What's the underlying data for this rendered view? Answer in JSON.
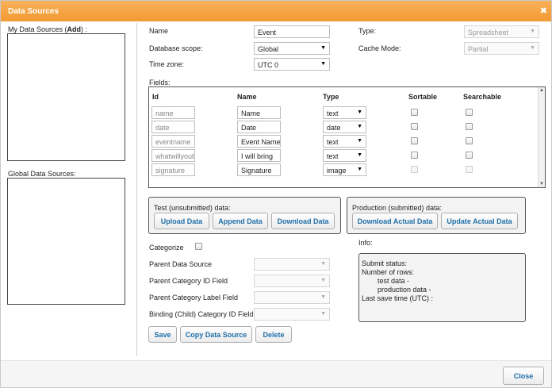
{
  "dialog": {
    "title": "Data Sources",
    "close_glyph": "✖"
  },
  "left": {
    "my_label_prefix": "My Data Sources (",
    "my_label_link": "Add",
    "my_label_suffix": ") :",
    "global_label": "Global Data Sources:"
  },
  "settings": {
    "name_label": "Name",
    "name_value": "Event",
    "scope_label": "Database scope:",
    "scope_value": "Global",
    "timezone_label": "Time zone:",
    "timezone_value": "UTC 0",
    "type_label": "Type:",
    "type_value": "Spreadsheet",
    "cache_label": "Cache Mode:",
    "cache_value": "Partial"
  },
  "fields": {
    "label": "Fields:",
    "headers": {
      "id": "Id",
      "name": "Name",
      "type": "Type",
      "sortable": "Sortable",
      "searchable": "Searchable"
    },
    "rows": [
      {
        "id": "name",
        "name": "Name",
        "type": "text",
        "checks_enabled": true
      },
      {
        "id": "date",
        "name": "Date",
        "type": "date",
        "checks_enabled": true
      },
      {
        "id": "eventname",
        "name": "Event Name",
        "type": "text",
        "checks_enabled": true
      },
      {
        "id": "whatwillyoubr",
        "name": "I will bring",
        "type": "text",
        "checks_enabled": true
      },
      {
        "id": "signature",
        "name": "Signature",
        "type": "image",
        "checks_enabled": false
      }
    ]
  },
  "test_group": {
    "title": "Test (unsubmitted) data:",
    "upload": "Upload Data",
    "append": "Append Data",
    "download": "Download Data"
  },
  "prod_group": {
    "title": "Production (submitted) data:",
    "download_actual": "Download Actual Data",
    "update_actual": "Update Actual Data"
  },
  "categorize": {
    "label": "Categorize",
    "parent_source": "Parent Data Source",
    "parent_id": "Parent Category ID Field",
    "parent_label": "Parent Category Label Field",
    "binding_id": "Binding (Child) Category ID Field"
  },
  "info": {
    "label": "Info:",
    "submit_status": "Submit status:",
    "number_rows": "Number of rows:",
    "test_data": "test data -",
    "production_data": "production data -",
    "last_save": "Last save time (UTC) :"
  },
  "actions": {
    "save": "Save",
    "copy": "Copy Data Source",
    "delete": "Delete"
  },
  "footer": {
    "close": "Close"
  }
}
